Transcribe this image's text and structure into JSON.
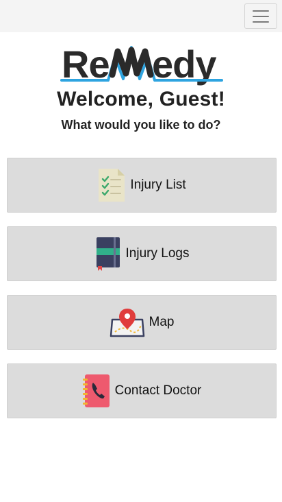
{
  "header": {
    "menu_icon": "hamburger-icon"
  },
  "logo": {
    "text": "ReMedy",
    "accent_color": "#2ea4e0",
    "text_color": "#2a2a2a"
  },
  "welcome": {
    "title": "Welcome, Guest!",
    "subtitle": "What would you like to do?"
  },
  "actions": [
    {
      "label": "Injury List",
      "icon": "checklist-document-icon"
    },
    {
      "label": "Injury Logs",
      "icon": "logbook-icon"
    },
    {
      "label": "Map",
      "icon": "map-pin-icon"
    },
    {
      "label": "Contact Doctor",
      "icon": "phone-book-icon"
    }
  ],
  "colors": {
    "button_bg": "#dcdcdc",
    "topbar_bg": "#f4f4f4"
  }
}
